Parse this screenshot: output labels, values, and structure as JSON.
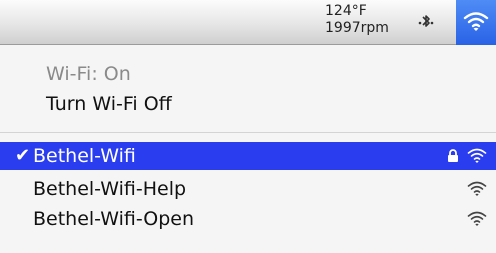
{
  "menubar": {
    "temperature": "124°F",
    "fan_speed": "1997rpm",
    "bluetooth_icon": "bluetooth-icon",
    "wifi_icon": "wifi-icon",
    "accent": "#2f6be9"
  },
  "menu": {
    "status": "Wi-Fi: On",
    "toggle_label": "Turn Wi-Fi Off",
    "networks": [
      {
        "name": "Bethel-Wifi",
        "selected": true,
        "checkmark": "✔",
        "locked": true
      },
      {
        "name": "Bethel-Wifi-Help",
        "selected": false,
        "locked": false
      },
      {
        "name": "Bethel-Wifi-Open",
        "selected": false,
        "locked": false
      }
    ],
    "highlight_color": "#2b3eef"
  }
}
